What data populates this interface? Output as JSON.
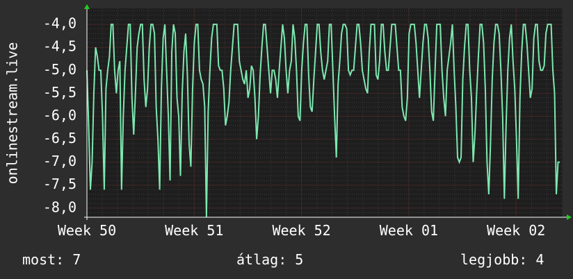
{
  "chart_data": {
    "type": "line",
    "title": "",
    "ylabel": "onlinestream.live",
    "xlabel": "",
    "ylim": [
      -8.2,
      -3.65
    ],
    "yticks": [
      -4.0,
      -4.5,
      -5.0,
      -5.5,
      -6.0,
      -6.5,
      -7.0,
      -7.5,
      -8.0
    ],
    "ytick_labels": [
      "-4,0",
      "-4,5",
      "-5,0",
      "-5,5",
      "-6,0",
      "-6,5",
      "-7,0",
      "-7,5",
      "-8,0"
    ],
    "x_domain": [
      0,
      4.433
    ],
    "xticks": [
      0,
      1,
      2,
      3,
      4
    ],
    "xtick_labels": [
      "Week 50",
      "Week 51",
      "Week 52",
      "Week 01",
      "Week 02"
    ],
    "grid": true,
    "colors": {
      "background": "#2d2d2d",
      "plot_background": "#1e1e1e",
      "line": "#7de8b0",
      "grid_major": "#6a2f2f",
      "grid_minor": "#3a3a3a",
      "axis_arrow": "#22cc22",
      "text": "#ffffff"
    },
    "series": [
      {
        "values": [
          -5.0,
          -6.2,
          -7.6,
          -7.0,
          -5.5,
          -4.5,
          -4.7,
          -5.0,
          -5.0,
          -6.0,
          -7.6,
          -5.4,
          -5.0,
          -4.7,
          -4.0,
          -4.0,
          -5.0,
          -5.5,
          -5.0,
          -4.8,
          -7.6,
          -6.0,
          -5.0,
          -4.5,
          -4.0,
          -4.0,
          -5.6,
          -6.4,
          -5.5,
          -4.5,
          -4.2,
          -4.0,
          -4.0,
          -5.2,
          -5.8,
          -5.4,
          -4.5,
          -4.0,
          -4.0,
          -4.2,
          -5.8,
          -6.5,
          -7.6,
          -5.4,
          -4.3,
          -4.0,
          -5.0,
          -6.0,
          -7.4,
          -4.6,
          -4.0,
          -4.2,
          -5.6,
          -6.0,
          -7.3,
          -5.5,
          -4.6,
          -4.2,
          -5.1,
          -6.6,
          -7.1,
          -5.4,
          -4.4,
          -4.0,
          -4.0,
          -5.0,
          -5.2,
          -5.3,
          -5.8,
          -8.2,
          -5.9,
          -5.0,
          -4.3,
          -4.0,
          -4.0,
          -4.0,
          -4.9,
          -5.0,
          -5.0,
          -5.4,
          -6.2,
          -6.0,
          -5.7,
          -5.0,
          -4.5,
          -4.0,
          -4.0,
          -4.0,
          -4.8,
          -5.0,
          -5.2,
          -5.3,
          -5.0,
          -5.6,
          -5.4,
          -4.9,
          -5.0,
          -5.6,
          -6.5,
          -6.0,
          -5.1,
          -4.5,
          -4.0,
          -4.0,
          -4.5,
          -5.0,
          -5.5,
          -5.0,
          -5.0,
          -5.2,
          -5.6,
          -5.0,
          -4.5,
          -4.0,
          -4.3,
          -5.0,
          -5.5,
          -5.0,
          -4.8,
          -4.0,
          -4.3,
          -5.0,
          -6.0,
          -6.1,
          -5.0,
          -4.4,
          -4.0,
          -4.0,
          -5.1,
          -5.8,
          -5.9,
          -5.2,
          -4.6,
          -4.0,
          -4.0,
          -4.6,
          -5.0,
          -5.2,
          -5.0,
          -4.8,
          -4.0,
          -4.0,
          -5.0,
          -6.0,
          -6.9,
          -5.3,
          -4.8,
          -4.2,
          -4.0,
          -4.0,
          -4.1,
          -5.0,
          -5.1,
          -5.0,
          -5.0,
          -4.5,
          -4.0,
          -4.0,
          -4.4,
          -5.0,
          -5.2,
          -5.4,
          -5.5,
          -4.6,
          -4.0,
          -4.0,
          -4.0,
          -5.1,
          -5.2,
          -4.8,
          -4.0,
          -4.0,
          -4.6,
          -5.0,
          -5.0,
          -4.5,
          -4.0,
          -4.0,
          -4.0,
          -4.5,
          -5.0,
          -5.0,
          -5.8,
          -6.0,
          -6.1,
          -5.6,
          -4.2,
          -4.0,
          -4.0,
          -4.0,
          -4.4,
          -5.0,
          -5.6,
          -5.0,
          -4.4,
          -4.0,
          -4.0,
          -4.3,
          -5.0,
          -5.9,
          -6.1,
          -5.0,
          -4.0,
          -4.0,
          -4.0,
          -5.0,
          -5.6,
          -6.0,
          -5.0,
          -4.7,
          -4.4,
          -4.0,
          -5.0,
          -5.8,
          -6.9,
          -7.0,
          -6.9,
          -5.2,
          -4.5,
          -4.0,
          -4.0,
          -5.0,
          -5.6,
          -7.0,
          -6.4,
          -5.5,
          -4.7,
          -4.0,
          -4.0,
          -4.4,
          -5.4,
          -7.0,
          -7.7,
          -6.6,
          -5.2,
          -4.4,
          -4.0,
          -4.0,
          -4.2,
          -5.0,
          -6.0,
          -7.8,
          -6.2,
          -5.0,
          -4.3,
          -4.0,
          -4.8,
          -5.4,
          -6.5,
          -7.8,
          -5.6,
          -4.6,
          -4.0,
          -4.0,
          -4.4,
          -5.0,
          -5.6,
          -5.4,
          -4.3,
          -4.0,
          -4.0,
          -4.8,
          -5.0,
          -5.0,
          -4.9,
          -4.2,
          -4.0,
          -4.0,
          -4.0,
          -5.0,
          -5.5,
          -7.7,
          -7.0,
          -7.0
        ]
      }
    ]
  },
  "stats": {
    "current": "most: 7",
    "average": "átlag: 5",
    "best": "legjobb: 4"
  }
}
